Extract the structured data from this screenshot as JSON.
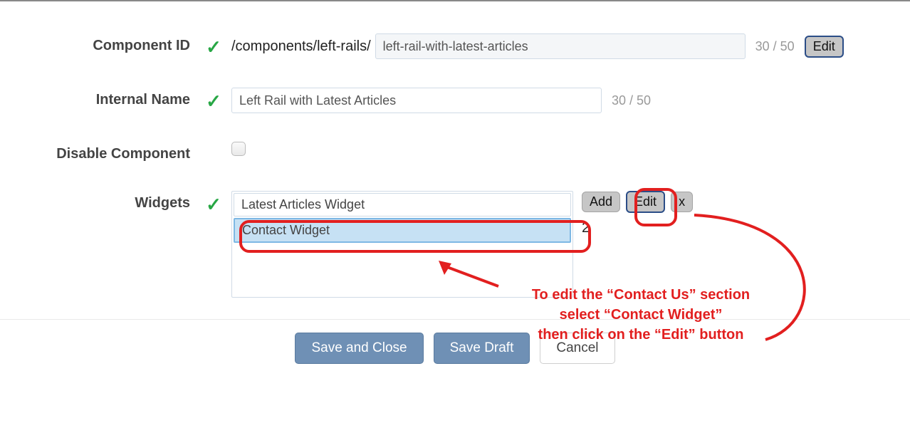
{
  "fields": {
    "component_id": {
      "label": "Component ID",
      "prefix": "/components/left-rails/",
      "value": "left-rail-with-latest-articles",
      "counter": "30 / 50",
      "edit": "Edit"
    },
    "internal_name": {
      "label": "Internal Name",
      "value": "Left Rail with Latest Articles",
      "counter": "30 / 50"
    },
    "disable": {
      "label": "Disable Component"
    },
    "widgets": {
      "label": "Widgets",
      "items": [
        "Latest Articles Widget",
        "Contact Widget"
      ],
      "add": "Add",
      "edit": "Edit",
      "remove": "x",
      "count": "2"
    }
  },
  "buttons": {
    "save_close": "Save and Close",
    "save_draft": "Save Draft",
    "cancel": "Cancel"
  },
  "annotation": {
    "line1": "To edit the “Contact Us” section",
    "line2": "select “Contact Widget”",
    "line3": "then click on the “Edit” button"
  }
}
